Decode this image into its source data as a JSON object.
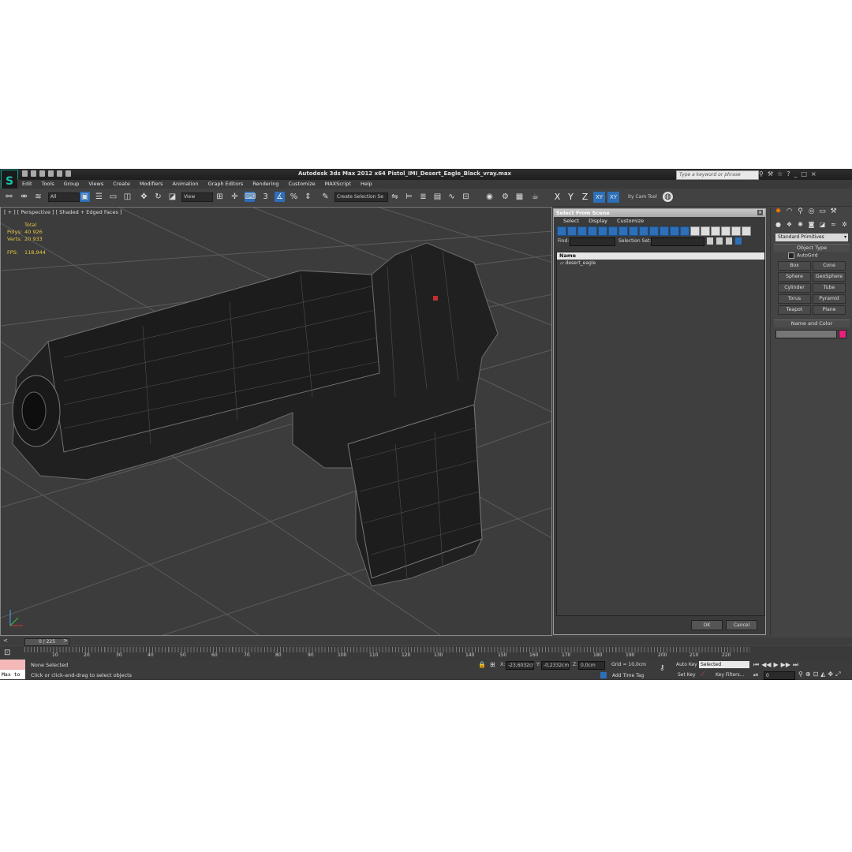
{
  "window": {
    "title": "Autodesk 3ds Max  2012 x64     Pistol_IMI_Desert_Eagle_Black_vray.max",
    "search_placeholder": "Type a keyword or phrase"
  },
  "menu": [
    "Edit",
    "Tools",
    "Group",
    "Views",
    "Create",
    "Modifiers",
    "Animation",
    "Graph Editors",
    "Rendering",
    "Customize",
    "MAXScript",
    "Help"
  ],
  "toolbar": {
    "filter": "All",
    "ref_coord": "View",
    "selection_set": "Create Selection Se",
    "axes": [
      "X",
      "Y",
      "Z",
      "XY",
      "XY"
    ],
    "cam_tool": "ity Cam Tool"
  },
  "viewport": {
    "label": "[ + ] [ Perspective ] [ Shaded + Edged Faces ]",
    "stats": {
      "header": "Total",
      "polys_label": "Polys:",
      "polys": "40 926",
      "verts_label": "Verts:",
      "verts": "20 933",
      "fps_label": "FPS:",
      "fps": "118,944"
    }
  },
  "dialog": {
    "title": "Select From Scene",
    "menu": [
      "Select",
      "Display",
      "Customize"
    ],
    "find_label": "Find:",
    "selset_label": "Selection Set:",
    "column": "Name",
    "items": [
      "desert_eagle"
    ],
    "ok": "OK",
    "cancel": "Cancel"
  },
  "command_panel": {
    "dropdown": "Standard Primitives",
    "object_type": "Object Type",
    "autogrid": "AutoGrid",
    "objects": [
      "Box",
      "Cone",
      "Sphere",
      "GeoSphere",
      "Cylinder",
      "Tube",
      "Torus",
      "Pyramid",
      "Teapot",
      "Plane"
    ],
    "name_color": "Name and Color",
    "color": "#e8207a"
  },
  "timeline": {
    "slider": "0 / 225",
    "ticks": [
      "10",
      "20",
      "30",
      "40",
      "50",
      "60",
      "70",
      "80",
      "90",
      "100",
      "110",
      "120",
      "130",
      "140",
      "150",
      "160",
      "170",
      "180",
      "190",
      "200",
      "210",
      "220"
    ]
  },
  "status": {
    "maxscript": "Max to",
    "selection": "None Selected",
    "prompt": "Click or click-and-drag to select objects",
    "x_label": "X:",
    "x": "-23,6032cr",
    "y_label": "Y:",
    "y": "-0,2332cm",
    "z_label": "Z:",
    "z": "0,0cm",
    "grid": "Grid = 10,0cm",
    "add_time_tag": "Add Time Tag",
    "auto_key": "Auto Key",
    "set_key": "Set Key",
    "key_mode": "Selected",
    "key_filters": "Key Filters...",
    "frame": "0"
  }
}
